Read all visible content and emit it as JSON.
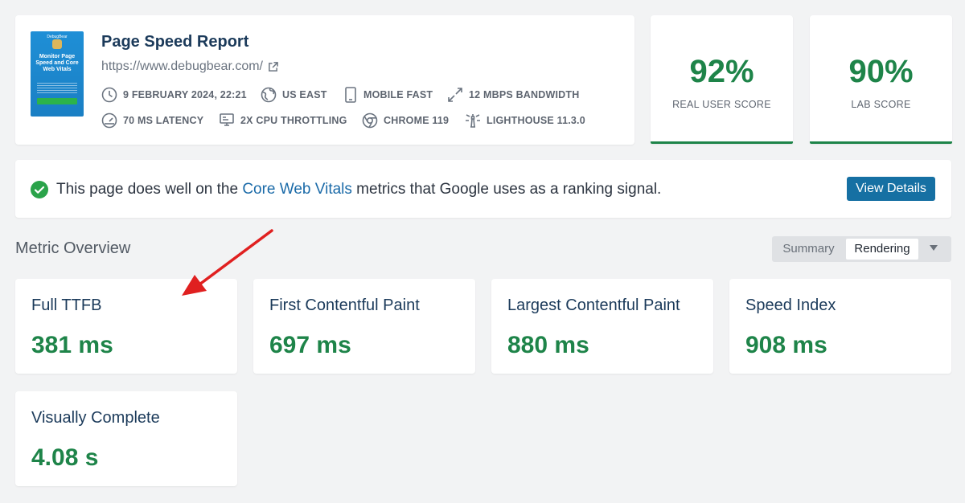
{
  "report": {
    "thumbnail": {
      "brand": "DebugBear",
      "headline": "Monitor Page Speed and Core Web Vitals"
    },
    "title": "Page Speed Report",
    "url": "https://www.debugbear.com/",
    "meta": {
      "date": "9 FEBRUARY 2024, 22:21",
      "location": "US EAST",
      "device": "MOBILE FAST",
      "bandwidth": "12 MBPS BANDWIDTH",
      "latency": "70 MS LATENCY",
      "cpu": "2X CPU THROTTLING",
      "browser": "CHROME 119",
      "lighthouse": "LIGHTHOUSE 11.3.0"
    }
  },
  "scores": {
    "real_user": {
      "value": "92%",
      "label": "REAL USER SCORE"
    },
    "lab": {
      "value": "90%",
      "label": "LAB SCORE"
    }
  },
  "cwv_banner": {
    "text_before": "This page does well on the ",
    "link": "Core Web Vitals",
    "text_after": " metrics that Google uses as a ranking signal.",
    "button": "View Details"
  },
  "metric_overview": {
    "title": "Metric Overview",
    "toggle": {
      "summary": "Summary",
      "rendering": "Rendering",
      "selected": "Rendering"
    },
    "metrics": [
      {
        "name": "Full TTFB",
        "value": "381 ms"
      },
      {
        "name": "First Contentful Paint",
        "value": "697 ms"
      },
      {
        "name": "Largest Contentful Paint",
        "value": "880 ms"
      },
      {
        "name": "Speed Index",
        "value": "908 ms"
      },
      {
        "name": "Visually Complete",
        "value": "4.08 s"
      }
    ]
  },
  "colors": {
    "good": "#1e8449",
    "link": "#1a6aa8",
    "button": "#1670a3",
    "annotation_arrow": "#e02020"
  },
  "icons": [
    "external-link-icon",
    "clock-icon",
    "globe-icon",
    "mobile-icon",
    "bandwidth-icon",
    "gauge-icon",
    "cpu-icon",
    "chrome-icon",
    "lighthouse-icon",
    "check-circle-icon",
    "chevron-down-icon"
  ]
}
